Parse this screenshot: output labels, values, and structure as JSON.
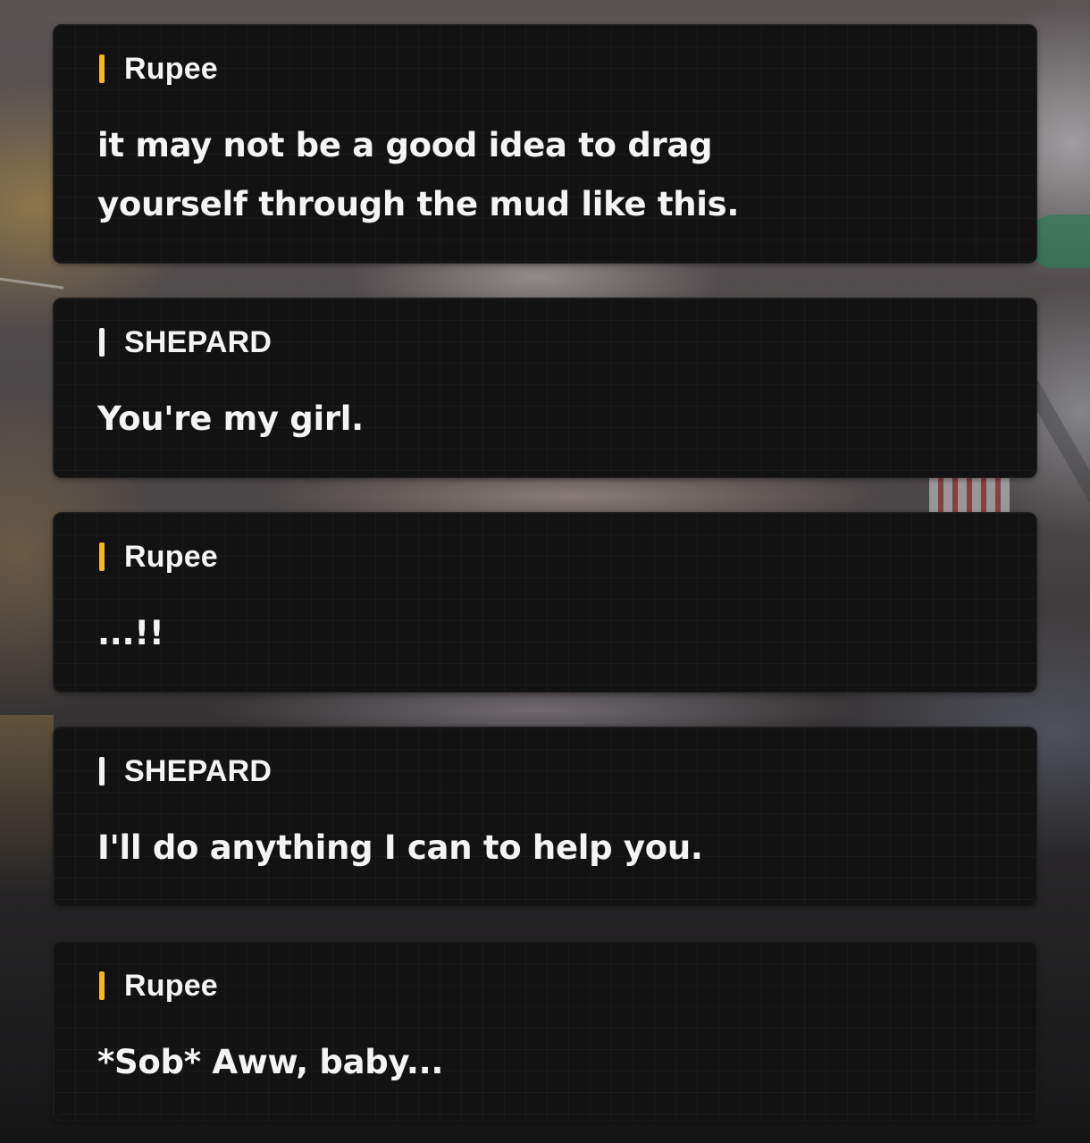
{
  "dialogue": [
    {
      "speaker": "Rupee",
      "text": "it may not be a good idea to drag yourself through the mud like this."
    },
    {
      "speaker": "SHEPARD",
      "text": "You're my girl."
    },
    {
      "speaker": "Rupee",
      "text": "...!!"
    },
    {
      "speaker": "SHEPARD",
      "text": "I'll do anything I can to help you."
    },
    {
      "speaker": "Rupee",
      "text": "*Sob* Aww, baby..."
    }
  ],
  "colors": {
    "rupee_marker": "#f6b81a",
    "shepard_marker": "#f2f2f2",
    "card_background": "#121212",
    "text": "#f4f4f4"
  }
}
